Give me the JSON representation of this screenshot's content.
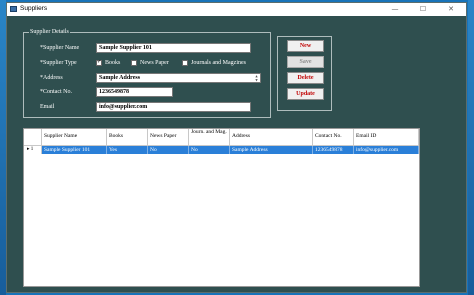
{
  "window": {
    "title": "Suppliers",
    "minimize": "—",
    "maximize": "☐",
    "close": "✕"
  },
  "details": {
    "legend": "Supplier Details",
    "name_label": "*Supplier Name",
    "name_value": "Sample Supplier 101",
    "type_label": "*Supplier Type",
    "type_options": [
      {
        "label": "Books",
        "checked": true
      },
      {
        "label": "News Paper",
        "checked": false
      },
      {
        "label": "Journals and Magzines",
        "checked": false
      }
    ],
    "address_label": "*Address",
    "address_value": "Sample Address",
    "contact_label": "*Contact No.",
    "contact_value": "1236549878",
    "email_label": "Email",
    "email_value": "info@supplier.com"
  },
  "buttons": {
    "new": "New",
    "save": "Save",
    "delete": "Delete",
    "update": "Update"
  },
  "grid": {
    "columns": [
      "Supplier Name",
      "Books",
      "News Paper",
      "Journ. and Mag.",
      "Address",
      "Contact No.",
      "Email ID"
    ],
    "rows": [
      {
        "marker": "▸",
        "index": "1",
        "cells": [
          "Sample Supplier 101",
          "Yes",
          "No",
          "No",
          "Sample Address",
          "1236549878",
          "info@supplier.com"
        ]
      }
    ]
  }
}
